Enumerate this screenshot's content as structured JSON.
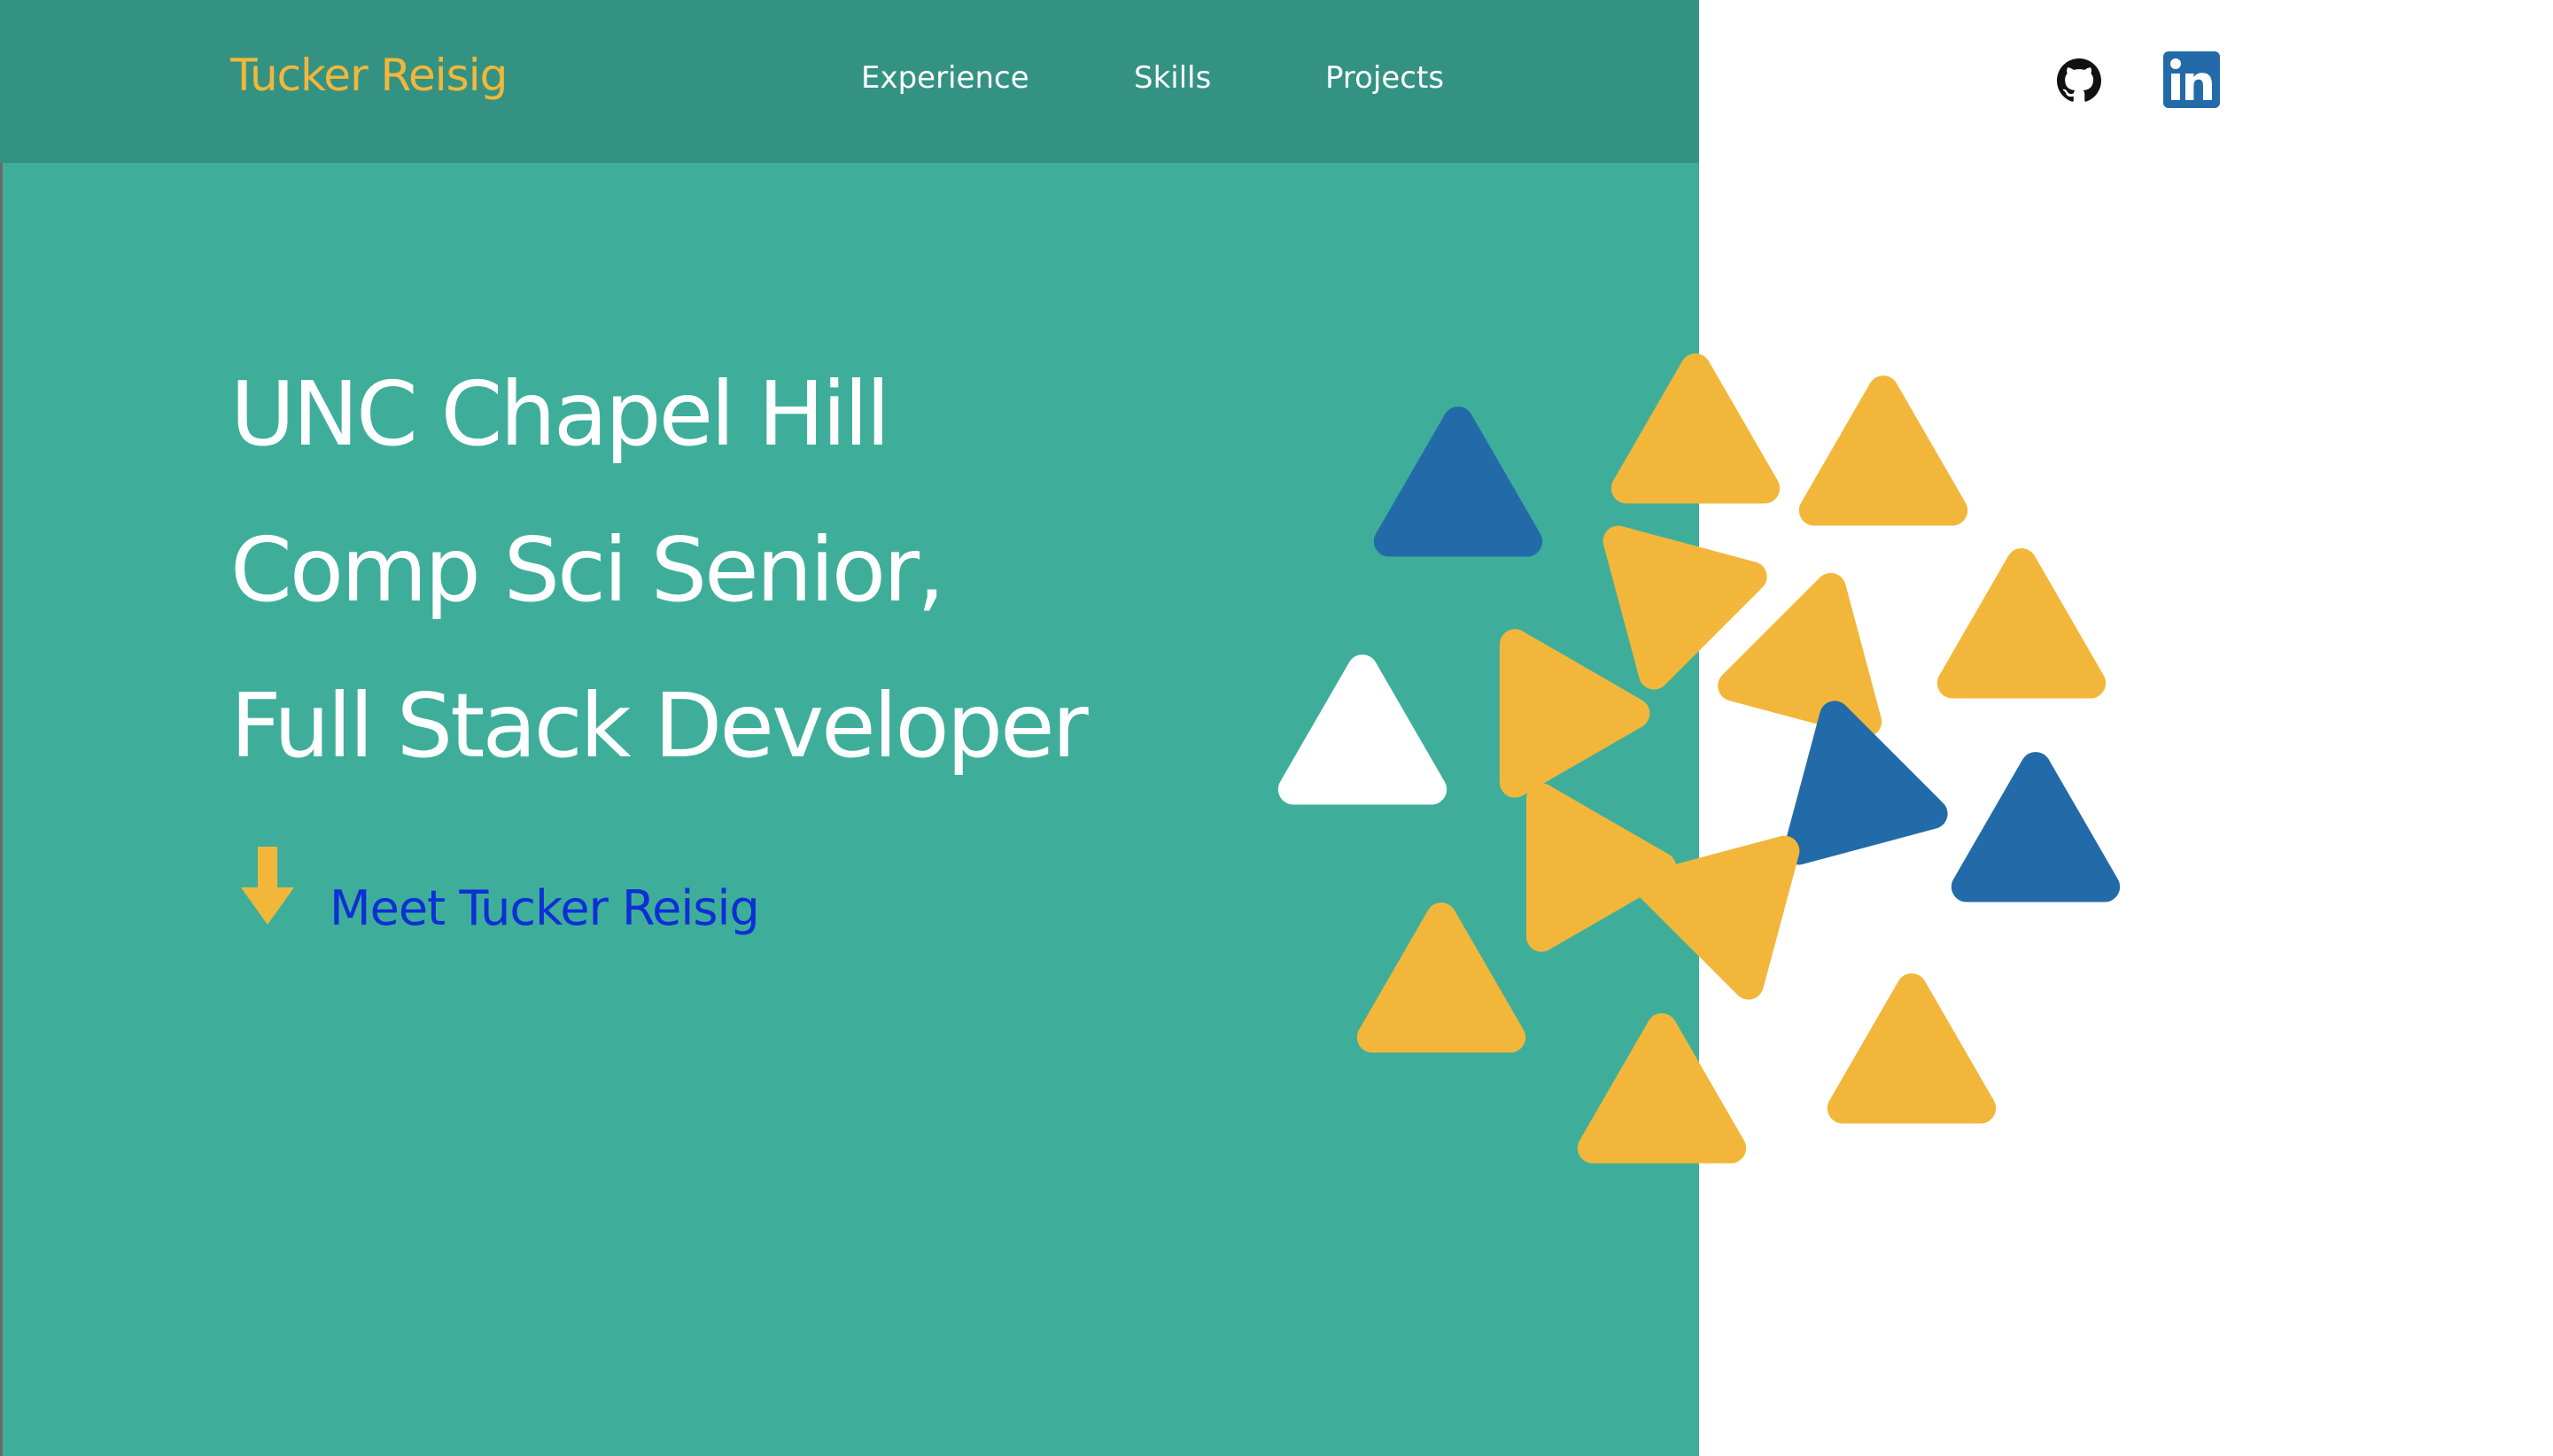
{
  "header": {
    "brand": "Tucker Reisig",
    "nav": [
      {
        "label": "Experience"
      },
      {
        "label": "Skills"
      },
      {
        "label": "Projects"
      }
    ],
    "social": [
      {
        "icon": "github-icon"
      },
      {
        "icon": "linkedin-icon"
      }
    ]
  },
  "hero": {
    "lines": [
      "UNC Chapel Hill",
      "Comp Sci Senior,",
      "Full Stack Developer"
    ],
    "cta_label": "Meet Tucker Reisig",
    "arrow_icon": "arrow-down-icon"
  },
  "colors": {
    "panel": "#3eae9b",
    "navbar": "#349283",
    "brand": "#f2b73a",
    "cta": "#0d2fd6",
    "triangle_yellow": "#f2b73a",
    "triangle_blue": "#226ba8",
    "triangle_white": "#ffffff"
  }
}
